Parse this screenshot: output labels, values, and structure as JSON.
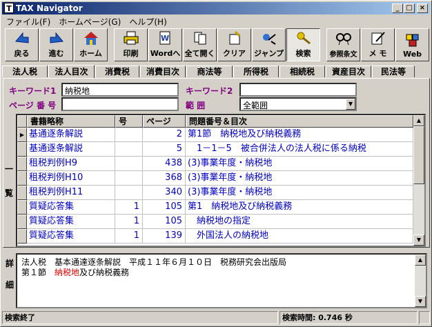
{
  "window": {
    "title": "TAX Navigator",
    "app_icon": "T"
  },
  "menu": [
    "ファイル(F)",
    "ホームページ(G)",
    "ヘルプ(H)"
  ],
  "toolbar": [
    {
      "label": "戻る",
      "icon": "back-arrow-icon"
    },
    {
      "label": "進む",
      "icon": "forward-arrow-icon"
    },
    {
      "label": "ホーム",
      "icon": "home-icon"
    },
    {
      "label": "印刷",
      "icon": "printer-icon"
    },
    {
      "label": "Wordへ",
      "icon": "word-icon"
    },
    {
      "label": "全て開く",
      "icon": "open-all-icon"
    },
    {
      "label": "クリア",
      "icon": "clear-icon"
    },
    {
      "label": "ジャンプ",
      "icon": "jump-icon"
    },
    {
      "label": "検索",
      "icon": "search-key-icon",
      "pressed": true
    },
    {
      "label": "参照条文",
      "icon": "reference-icon"
    },
    {
      "label": "メ モ",
      "icon": "memo-icon"
    },
    {
      "label": "Web",
      "icon": "web-icon"
    }
  ],
  "tabs": [
    "法人税",
    "法人目次",
    "消費税",
    "消費目次",
    "商法等",
    "所得税",
    "相続税",
    "資産目次",
    "民法等"
  ],
  "active_tab": 1,
  "search": {
    "keyword1_label": "キーワード1",
    "keyword1_value": "納税地",
    "keyword2_label": "キーワード2",
    "keyword2_value": "",
    "page_label": "ページ 番 号",
    "page_value": "",
    "range_label": "範 囲",
    "range_value": "全範囲"
  },
  "list_side_label": [
    "一",
    "覧"
  ],
  "grid": {
    "headers": [
      "書籍略称",
      "号",
      "ページ",
      "問題番号＆目次"
    ],
    "rows": [
      {
        "book": "基通逐条解説",
        "no": "",
        "page": "2",
        "title": "第1節　納税地及び納税義務",
        "current": true
      },
      {
        "book": "基通逐条解説",
        "no": "",
        "page": "5",
        "title": "　1－1－5　被合併法人の法人税に係る納税"
      },
      {
        "book": "租税判例H9",
        "no": "",
        "page": "438",
        "title": "(3)事業年度・納税地"
      },
      {
        "book": "租税判例H10",
        "no": "",
        "page": "368",
        "title": "(3)事業年度・納税地"
      },
      {
        "book": "租税判例H11",
        "no": "",
        "page": "340",
        "title": "(3)事業年度・納税地"
      },
      {
        "book": "質疑応答集",
        "no": "1",
        "page": "105",
        "title": "第1　納税地及び納税義務"
      },
      {
        "book": "質疑応答集",
        "no": "1",
        "page": "105",
        "title": "　納税地の指定"
      },
      {
        "book": "質疑応答集",
        "no": "1",
        "page": "139",
        "title": "　外国法人の納税地"
      }
    ]
  },
  "detail_side_label": [
    "詳",
    "細"
  ],
  "detail": {
    "line1": "法人税　基本通達逐条解説　平成１１年６月１０日　税務研究会出版局",
    "line2_pre": "第１節　",
    "line2_hit": "納税地",
    "line2_post": "及び納税義務",
    "highlight_color": "#e00000"
  },
  "status": {
    "left": "検索終了",
    "right": "検索時間: 0.746 秒"
  }
}
